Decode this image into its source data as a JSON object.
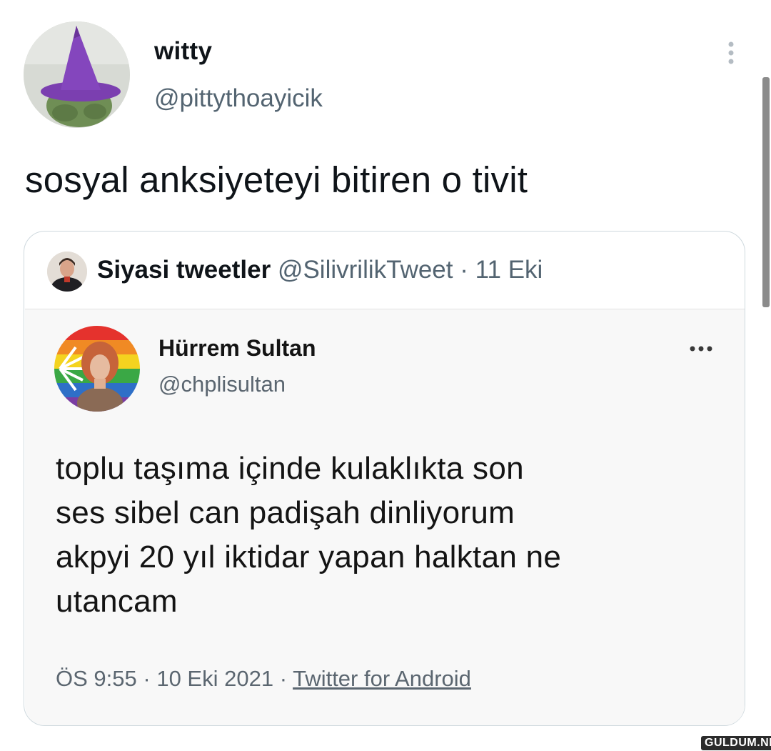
{
  "tweet": {
    "author_name": "witty",
    "author_handle": "@pittythoayicik",
    "text": "sosyal anksiyeteyi bitiren o tivit",
    "more_icon": "more-vertical-icon"
  },
  "quote": {
    "author_name": "Siyasi tweetler",
    "author_handle": "@SilivrilikTweet",
    "separator": "·",
    "date": "11 Eki"
  },
  "embedded_tweet": {
    "author_name": "Hürrem Sultan",
    "author_handle": "@chplisultan",
    "more_icon": "more-horizontal-icon",
    "text_lines": [
      "toplu taşıma içinde kulaklıkta son",
      "ses sibel can padişah dinliyorum",
      "akpyi 20 yıl iktidar yapan halktan ne",
      "utancam"
    ],
    "time": "ÖS 9:55",
    "separator": "·",
    "date": "10 Eki 2021",
    "source": "Twitter for Android"
  },
  "watermark": "GULDUM.NET",
  "colors": {
    "text": "#0f1419",
    "secondary": "#536471",
    "border": "#cfd9de",
    "hat_purple": "#7b3fb0"
  }
}
